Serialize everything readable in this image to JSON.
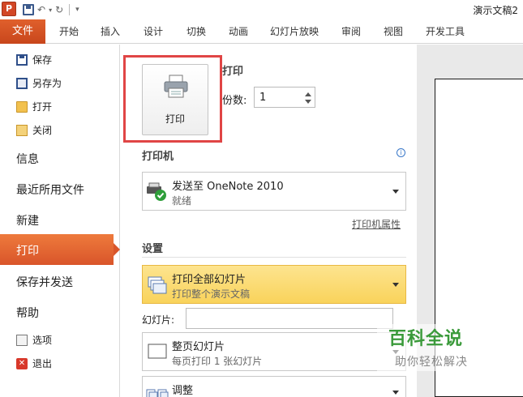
{
  "window": {
    "app_icon_letter": "P",
    "title": "演示文稿2"
  },
  "ribbon": {
    "file_tab": "文件",
    "tabs": [
      "开始",
      "插入",
      "设计",
      "切换",
      "动画",
      "幻灯片放映",
      "审阅",
      "视图",
      "开发工具"
    ]
  },
  "backstage_nav": {
    "small_items_top": [
      {
        "label": "保存",
        "icon": "save-icon"
      },
      {
        "label": "另存为",
        "icon": "save-as-icon"
      },
      {
        "label": "打开",
        "icon": "open-folder-icon"
      },
      {
        "label": "关闭",
        "icon": "close-folder-icon"
      }
    ],
    "big_items": [
      "信息",
      "最近所用文件",
      "新建",
      "打印",
      "保存并发送",
      "帮助"
    ],
    "active_item": "打印",
    "small_items_bottom": [
      {
        "label": "选项",
        "icon": "options-icon"
      },
      {
        "label": "退出",
        "icon": "exit-icon"
      }
    ]
  },
  "print_panel": {
    "section_title": "打印",
    "print_button_label": "打印",
    "copies_label": "份数:",
    "copies_value": "1",
    "printer_section_title": "打印机",
    "printer": {
      "name": "发送至 OneNote 2010",
      "status": "就绪"
    },
    "printer_properties_link": "打印机属性",
    "settings_section_title": "设置",
    "print_range": {
      "main": "打印全部幻灯片",
      "sub": "打印整个演示文稿"
    },
    "slides_label": "幻灯片:",
    "slides_value": "",
    "layout": {
      "main": "整页幻灯片",
      "sub": "每页打印 1 张幻灯片"
    },
    "collate": {
      "main": "调整"
    }
  },
  "watermark": {
    "title": "百科全说",
    "subtitle": "助你轻松解决"
  },
  "colors": {
    "accent": "#d9552a",
    "highlight_border": "#e04545",
    "selected_dropdown": "#f9d35b"
  }
}
